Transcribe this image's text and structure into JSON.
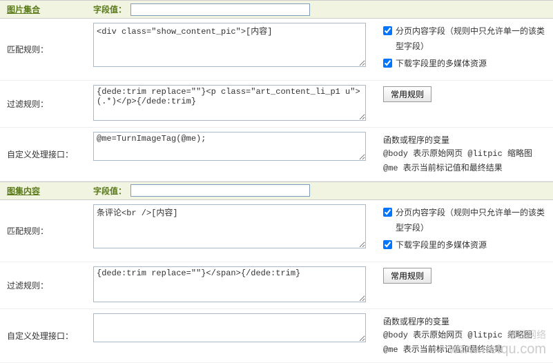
{
  "sections": [
    {
      "title": "图片集合",
      "field_value_label": "字段值：",
      "field_value": "",
      "match": {
        "label": "匹配规则：",
        "value": "<div class=\"show_content_pic\">[内容]",
        "chk1": {
          "checked": true,
          "label": "分页内容字段（规则中只允许单一的该类型字段）"
        },
        "chk2": {
          "checked": true,
          "label": "下载字段里的多媒体资源"
        }
      },
      "filter": {
        "label": "过滤规则：",
        "value": "{dede:trim replace=\"\"}<p class=\"art_content_li_p1 u\">(.*)</p>{/dede:trim}",
        "button": "常用规则"
      },
      "custom": {
        "label": "自定义处理接口：",
        "value": "@me=TurnImageTag(@me);",
        "help_title": "函数或程序的变量",
        "help_line1": "@body 表示原始网页 @litpic 缩略图",
        "help_line2": "@me 表示当前标记值和最终结果"
      }
    },
    {
      "title": "图集内容",
      "field_value_label": "字段值：",
      "field_value": "",
      "match": {
        "label": "匹配规则：",
        "value": "条评论<br />[内容]",
        "chk1": {
          "checked": true,
          "label": "分页内容字段（规则中只允许单一的该类型字段）"
        },
        "chk2": {
          "checked": true,
          "label": "下载字段里的多媒体资源"
        }
      },
      "filter": {
        "label": "过滤规则：",
        "value": "{dede:trim replace=\"\"}</span>{/dede:trim}",
        "button": "常用规则"
      },
      "custom": {
        "label": "自定义处理接口：",
        "value": "",
        "help_title": "函数或程序的变量",
        "help_line1": "@body 表示原始网页 @litpic 缩略图",
        "help_line2": "@me 表示当前标记值和最终结果"
      }
    }
  ],
  "watermark": {
    "line1": "帮区网络",
    "line2": "www.netqu.com"
  }
}
